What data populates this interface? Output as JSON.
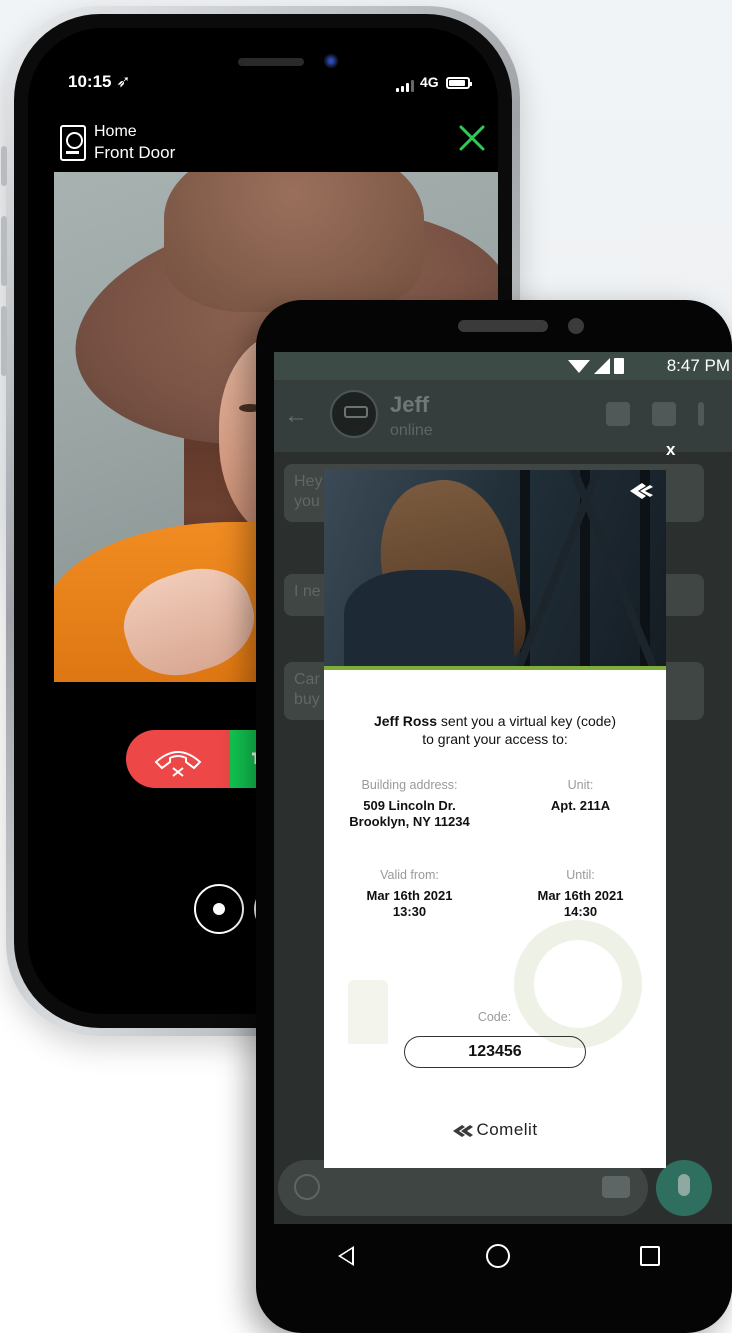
{
  "ios": {
    "status": {
      "time": "10:15",
      "network": "4G"
    },
    "header": {
      "location": "Home",
      "door": "Front Door"
    },
    "colors": {
      "decline": "#ee4747",
      "accept": "#12c652",
      "close": "#2ecc52"
    },
    "icons": [
      "door-station-icon",
      "close-icon",
      "hangup-icon",
      "key-icon"
    ]
  },
  "android": {
    "status": {
      "time": "8:47 PM"
    },
    "chat": {
      "contact": "Jeff",
      "presence": "online",
      "bubbles": [
        "Hey",
        "you",
        "I ne",
        "Car",
        "buy"
      ]
    },
    "modal": {
      "close": "x",
      "sender": "Jeff Ross",
      "message_line1": " sent you a virtual key (code)",
      "message_line2": "to grant your access to:",
      "building_label": "Building address:",
      "building_value": "509 Lincoln Dr.\nBrooklyn, NY 11234",
      "unit_label": "Unit:",
      "unit_value": "Apt. 211A",
      "valid_from_label": "Valid from:",
      "valid_from_value": "Mar 16th 2021\n13:30",
      "until_label": "Until:",
      "until_value": "Mar 16th 2021\n14:30",
      "code_label": "Code:",
      "code_value": "123456",
      "brand": "Comelit"
    },
    "colors": {
      "accent": "#7fae38"
    }
  }
}
